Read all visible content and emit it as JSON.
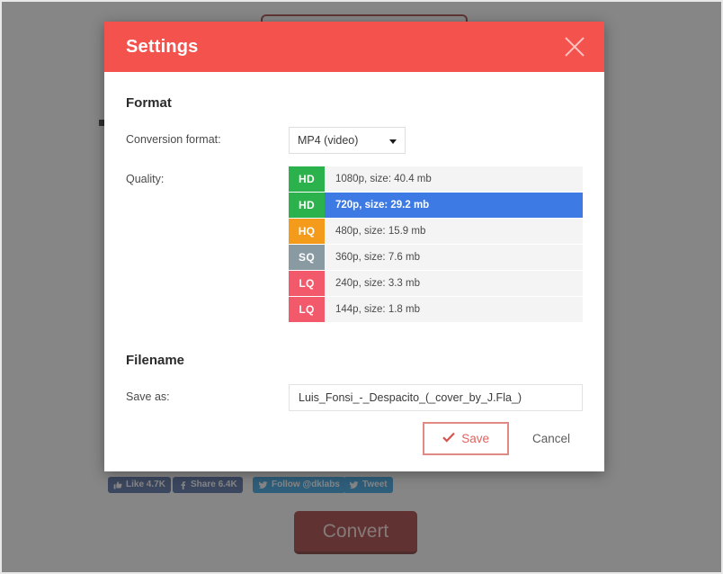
{
  "background": {
    "convert_button_label": "Convert",
    "social_buttons": [
      {
        "name": "facebook-like",
        "label": "Like 4.7K",
        "icon": "thumbs-up-icon",
        "color": "#3b5998"
      },
      {
        "name": "facebook-share",
        "label": "Share 6.4K",
        "icon": "facebook-icon",
        "color": "#3b5998"
      },
      {
        "name": "twitter-follow",
        "label": "Follow @dklabs",
        "icon": "twitter-icon",
        "color": "#1b95e0"
      },
      {
        "name": "twitter-tweet",
        "label": "Tweet",
        "icon": "twitter-icon",
        "color": "#1b95e0"
      }
    ]
  },
  "modal": {
    "title": "Settings",
    "header_color": "#f4524d",
    "close_icon": "close-icon",
    "format": {
      "section_title": "Format",
      "conversion_format_label": "Conversion format:",
      "conversion_format_value": "MP4 (video)",
      "quality_label": "Quality:",
      "selected_index": 1,
      "selected_color": "#3e7ae4",
      "options": [
        {
          "badge": "HD",
          "badge_color": "#2bb24c",
          "text": "1080p, size: 40.4 mb"
        },
        {
          "badge": "HD",
          "badge_color": "#2bb24c",
          "text": "720p, size: 29.2 mb"
        },
        {
          "badge": "HQ",
          "badge_color": "#f59b1c",
          "text": "480p, size: 15.9 mb"
        },
        {
          "badge": "SQ",
          "badge_color": "#8a9aa3",
          "text": "360p, size: 7.6 mb"
        },
        {
          "badge": "LQ",
          "badge_color": "#f2596b",
          "text": "240p, size: 3.3 mb"
        },
        {
          "badge": "LQ",
          "badge_color": "#f2596b",
          "text": "144p, size: 1.8 mb"
        }
      ]
    },
    "filename": {
      "section_title": "Filename",
      "save_as_label": "Save as:",
      "value": "Luis_Fonsi_-_Despacito_(_cover_by_J.Fla_)",
      "placeholder": "Filename"
    },
    "footer": {
      "save_label": "Save",
      "save_icon": "check-icon",
      "cancel_label": "Cancel"
    }
  }
}
